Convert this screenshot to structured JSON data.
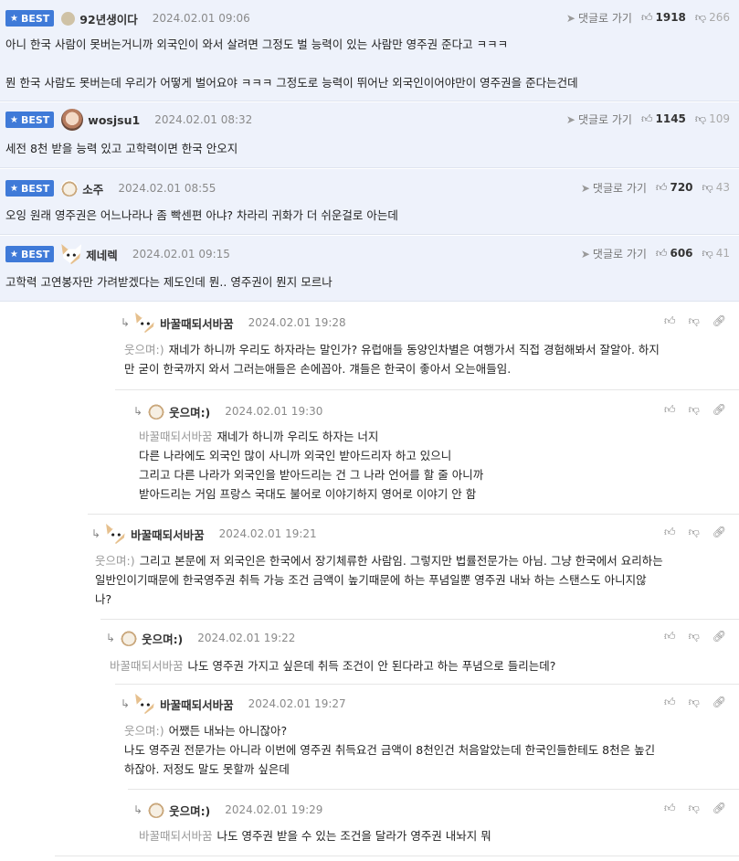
{
  "best_label": "BEST",
  "reply_label": "댓글로 가기",
  "best_comments": [
    {
      "nick": "92년생이다",
      "date": "2024.02.01 09:06",
      "likes": "1918",
      "dislikes": "266",
      "lines": [
        "아니 한국 사람이 못버는거니까 외국인이 와서 살려면 그정도 벌 능력이 있는 사람만 영주권 준다고 ㅋㅋㅋ",
        "",
        "뭔 한국 사람도 못버는데 우리가 어떻게 벌어요야 ㅋㅋㅋ 그정도로 능력이 뛰어난 외국인이어야만이 영주권을 준다는건데"
      ]
    },
    {
      "nick": "wosjsu1",
      "date": "2024.02.01 08:32",
      "likes": "1145",
      "dislikes": "109",
      "lines": [
        "세전 8천 받을 능력 있고 고학력이면 한국 안오지"
      ]
    },
    {
      "nick": "소주",
      "date": "2024.02.01 08:55",
      "likes": "720",
      "dislikes": "43",
      "lines": [
        "오잉 원래 영주권은 어느나라나 좀 빡센편 아냐? 차라리 귀화가 더 쉬운걸로 아는데"
      ]
    },
    {
      "nick": "제네렉",
      "date": "2024.02.01 09:15",
      "likes": "606",
      "dislikes": "41",
      "lines": [
        "고학력 고연봉자만 가려받겠다는 제도인데 뭔.. 영주권이 뭔지 모르나"
      ]
    }
  ],
  "replies": [
    {
      "nick": "바꿀때되서바꿈",
      "date": "2024.02.01 19:28",
      "mention": "웃으며:)",
      "lines": [
        "재네가 하니까 우리도 하자라는 말인가? 유럽애들 동양인차별은 여행가서 직접 경험해봐서 잘알아. 하지",
        "만 굳이 한국까지 와서 그러는애들은 손에꼽아. 걔들은 한국이 좋아서 오는애들임."
      ]
    },
    {
      "nick": "웃으며:)",
      "date": "2024.02.01 19:30",
      "mention": "바꿀때되서바꿈",
      "lines": [
        "재네가 하니까 우리도 하자는 너지",
        "다른 나라에도 외국인 많이 사니까 외국인 받아드리자 하고 있으니",
        "그리고 다른 나라가 외국인을 받아드리는 건 그 나라 언어를 할 줄 아니까",
        "받아드리는 거임 프랑스 국대도 불어로 이야기하지 영어로 이야기 안 함"
      ]
    },
    {
      "nick": "바꿀때되서바꿈",
      "date": "2024.02.01 19:21",
      "mention": "웃으며:)",
      "lines": [
        "그리고 본문에 저 외국인은 한국에서 장기체류한 사람임. 그렇지만 법률전문가는 아님. 그냥 한국에서 요리하는",
        "일반인이기때문에 한국영주권 취득 가능 조건 금액이 높기때문에 하는 푸념일뿐 영주권 내놔 하는 스탠스도 아니지않",
        "나?"
      ]
    },
    {
      "nick": "웃으며:)",
      "date": "2024.02.01 19:22",
      "mention": "바꿀때되서바꿈",
      "lines": [
        "나도 영주권 가지고 싶은데 취득 조건이 안 된다라고 하는 푸념으로 들리는데?"
      ]
    },
    {
      "nick": "바꿀때되서바꿈",
      "date": "2024.02.01 19:27",
      "mention": "웃으며:)",
      "lines": [
        "어쨌든 내놔는 아니잖아?",
        "나도 영주권 전문가는 아니라 이번에 영주권 취득요건 금액이 8천인건 처음알았는데 한국인들한테도 8천은 높긴",
        "하잖아. 저정도 말도 못할까 싶은데"
      ]
    },
    {
      "nick": "웃으며:)",
      "date": "2024.02.01 19:29",
      "mention": "바꿀때되서바꿈",
      "lines": [
        "나도 영주권 받을 수 있는 조건을 달라가 영주권 내놔지 뭐"
      ]
    }
  ]
}
